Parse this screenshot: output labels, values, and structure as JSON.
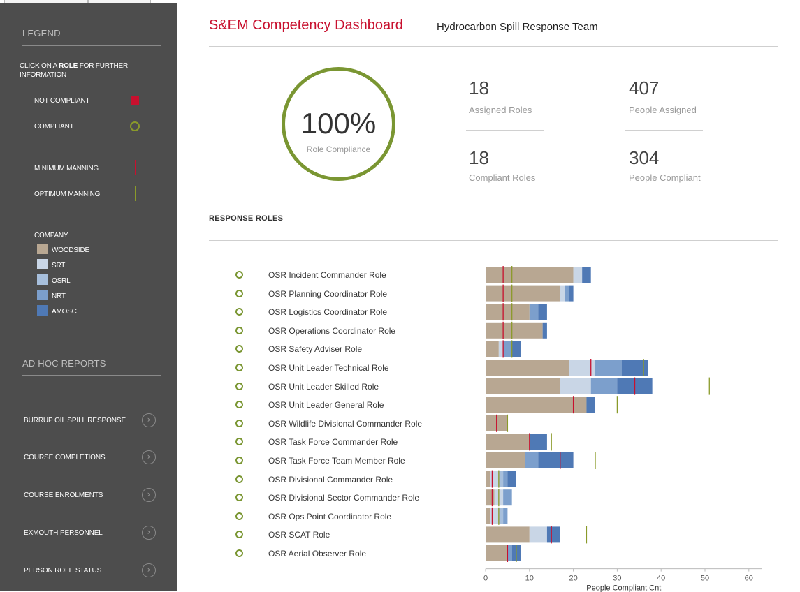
{
  "colors": {
    "sidebar_bg": "#4d4d4d",
    "accent_red": "#c8102e",
    "compliant_green": "#7a9632",
    "min_manning_line": "#c8102e",
    "opt_manning_line": "#8a9a2a",
    "woodside": "#b8a792",
    "srt": "#c9d6e6",
    "osrl": "#a7bfdc",
    "nrt": "#7c9fcc",
    "amosc": "#4f79b5"
  },
  "legend": {
    "heading": "LEGEND",
    "instruction_pre": "CLICK ON A ",
    "instruction_bold": "ROLE",
    "instruction_post": " FOR FURTHER INFORMATION",
    "not_compliant": "NOT COMPLIANT",
    "compliant": "COMPLIANT",
    "minimum_manning": "MINIMUM MANNING",
    "optimum_manning": "OPTIMUM MANNING",
    "company_heading": "COMPANY",
    "companies": [
      {
        "name": "WOODSIDE",
        "color": "#b8a792"
      },
      {
        "name": "SRT",
        "color": "#c9d6e6"
      },
      {
        "name": "OSRL",
        "color": "#a7bfdc"
      },
      {
        "name": "NRT",
        "color": "#7c9fcc"
      },
      {
        "name": "AMOSC",
        "color": "#4f79b5"
      }
    ]
  },
  "adhoc": {
    "heading": "AD HOC REPORTS",
    "items": [
      {
        "label": "BURRUP OIL SPILL RESPONSE",
        "icon": "chevron-right-icon"
      },
      {
        "label": "COURSE COMPLETIONS",
        "icon": "chevron-right-icon"
      },
      {
        "label": "COURSE ENROLMENTS",
        "icon": "chevron-right-icon"
      },
      {
        "label": "EXMOUTH PERSONNEL",
        "icon": "chevron-right-icon"
      },
      {
        "label": "PERSON ROLE STATUS",
        "icon": "chevron-right-icon"
      }
    ]
  },
  "header": {
    "title": "S&EM Competency Dashboard",
    "subtitle": "Hydrocarbon Spill Response Team"
  },
  "kpis": {
    "compliance_pct": "100%",
    "compliance_label": "Role Compliance",
    "assigned_roles": "18",
    "assigned_roles_label": "Assigned Roles",
    "compliant_roles": "18",
    "compliant_roles_label": "Compliant Roles",
    "people_assigned": "407",
    "people_assigned_label": "People Assigned",
    "people_compliant": "304",
    "people_compliant_label": "People Compliant"
  },
  "section_title": "RESPONSE ROLES",
  "roles": [
    "OSR Incident Commander Role",
    "OSR Planning Coordinator Role",
    "OSR Logistics Coordinator Role",
    "OSR Operations Coordinator Role",
    "OSR Safety Adviser Role",
    "OSR Unit Leader Technical Role",
    "OSR Unit Leader Skilled Role",
    "OSR Unit Leader General Role",
    "OSR Wildlife Divisional Commander Role",
    "OSR Task Force Commander Role",
    "OSR Task Force Team Member Role",
    "OSR Divisional Commander Role",
    "OSR Divisional Sector Commander Role",
    "OSR Ops Point Coordinator Role",
    "OSR SCAT Role",
    "OSR Aerial Observer Role"
  ],
  "chart_data": {
    "type": "bar",
    "orientation": "horizontal",
    "stacked": true,
    "xlabel": "People Compliant Cnt",
    "xlim": [
      0,
      63
    ],
    "xticks": [
      0,
      10,
      20,
      30,
      40,
      50,
      60
    ],
    "categories": [
      "OSR Incident Commander Role",
      "OSR Planning Coordinator Role",
      "OSR Logistics Coordinator Role",
      "OSR Operations Coordinator Role",
      "OSR Safety Adviser Role",
      "OSR Unit Leader Technical Role",
      "OSR Unit Leader Skilled Role",
      "OSR Unit Leader General Role",
      "OSR Wildlife Divisional Commander Role",
      "OSR Task Force Commander Role",
      "OSR Task Force Team Member Role",
      "OSR Divisional Commander Role",
      "OSR Divisional Sector Commander Role",
      "OSR Ops Point Coordinator Role",
      "OSR SCAT Role",
      "OSR Aerial Observer Role"
    ],
    "series": [
      {
        "name": "WOODSIDE",
        "color": "#b8a792",
        "values": [
          20,
          17,
          10,
          13,
          3,
          19,
          17,
          23,
          5,
          10,
          9,
          1,
          2,
          1,
          10,
          5
        ]
      },
      {
        "name": "SRT",
        "color": "#c9d6e6",
        "values": [
          2,
          1,
          0,
          0,
          1,
          6,
          7,
          0,
          0,
          0,
          0,
          2,
          2,
          2,
          4,
          0
        ]
      },
      {
        "name": "OSRL",
        "color": "#a7bfdc",
        "values": [
          0,
          0,
          0,
          0,
          0,
          0,
          0,
          0,
          0,
          0,
          0,
          1,
          0,
          1,
          0,
          0
        ]
      },
      {
        "name": "NRT",
        "color": "#7c9fcc",
        "values": [
          0,
          1,
          2,
          0,
          2,
          6,
          6,
          0,
          0,
          0,
          3,
          1,
          2,
          1,
          0,
          1
        ]
      },
      {
        "name": "AMOSC",
        "color": "#4f79b5",
        "values": [
          2,
          1,
          2,
          1,
          2,
          6,
          8,
          2,
          0,
          4,
          8,
          2,
          0,
          0,
          3,
          2
        ]
      }
    ],
    "minimum_manning": [
      4,
      4,
      4,
      4,
      4,
      24,
      34,
      20,
      2.5,
      10,
      17,
      1.5,
      1.5,
      1.5,
      15,
      5
    ],
    "optimum_manning": [
      6,
      6,
      6,
      6,
      6,
      36,
      51,
      30,
      5,
      15,
      25,
      3,
      3,
      3,
      23,
      7
    ],
    "grid": false
  }
}
